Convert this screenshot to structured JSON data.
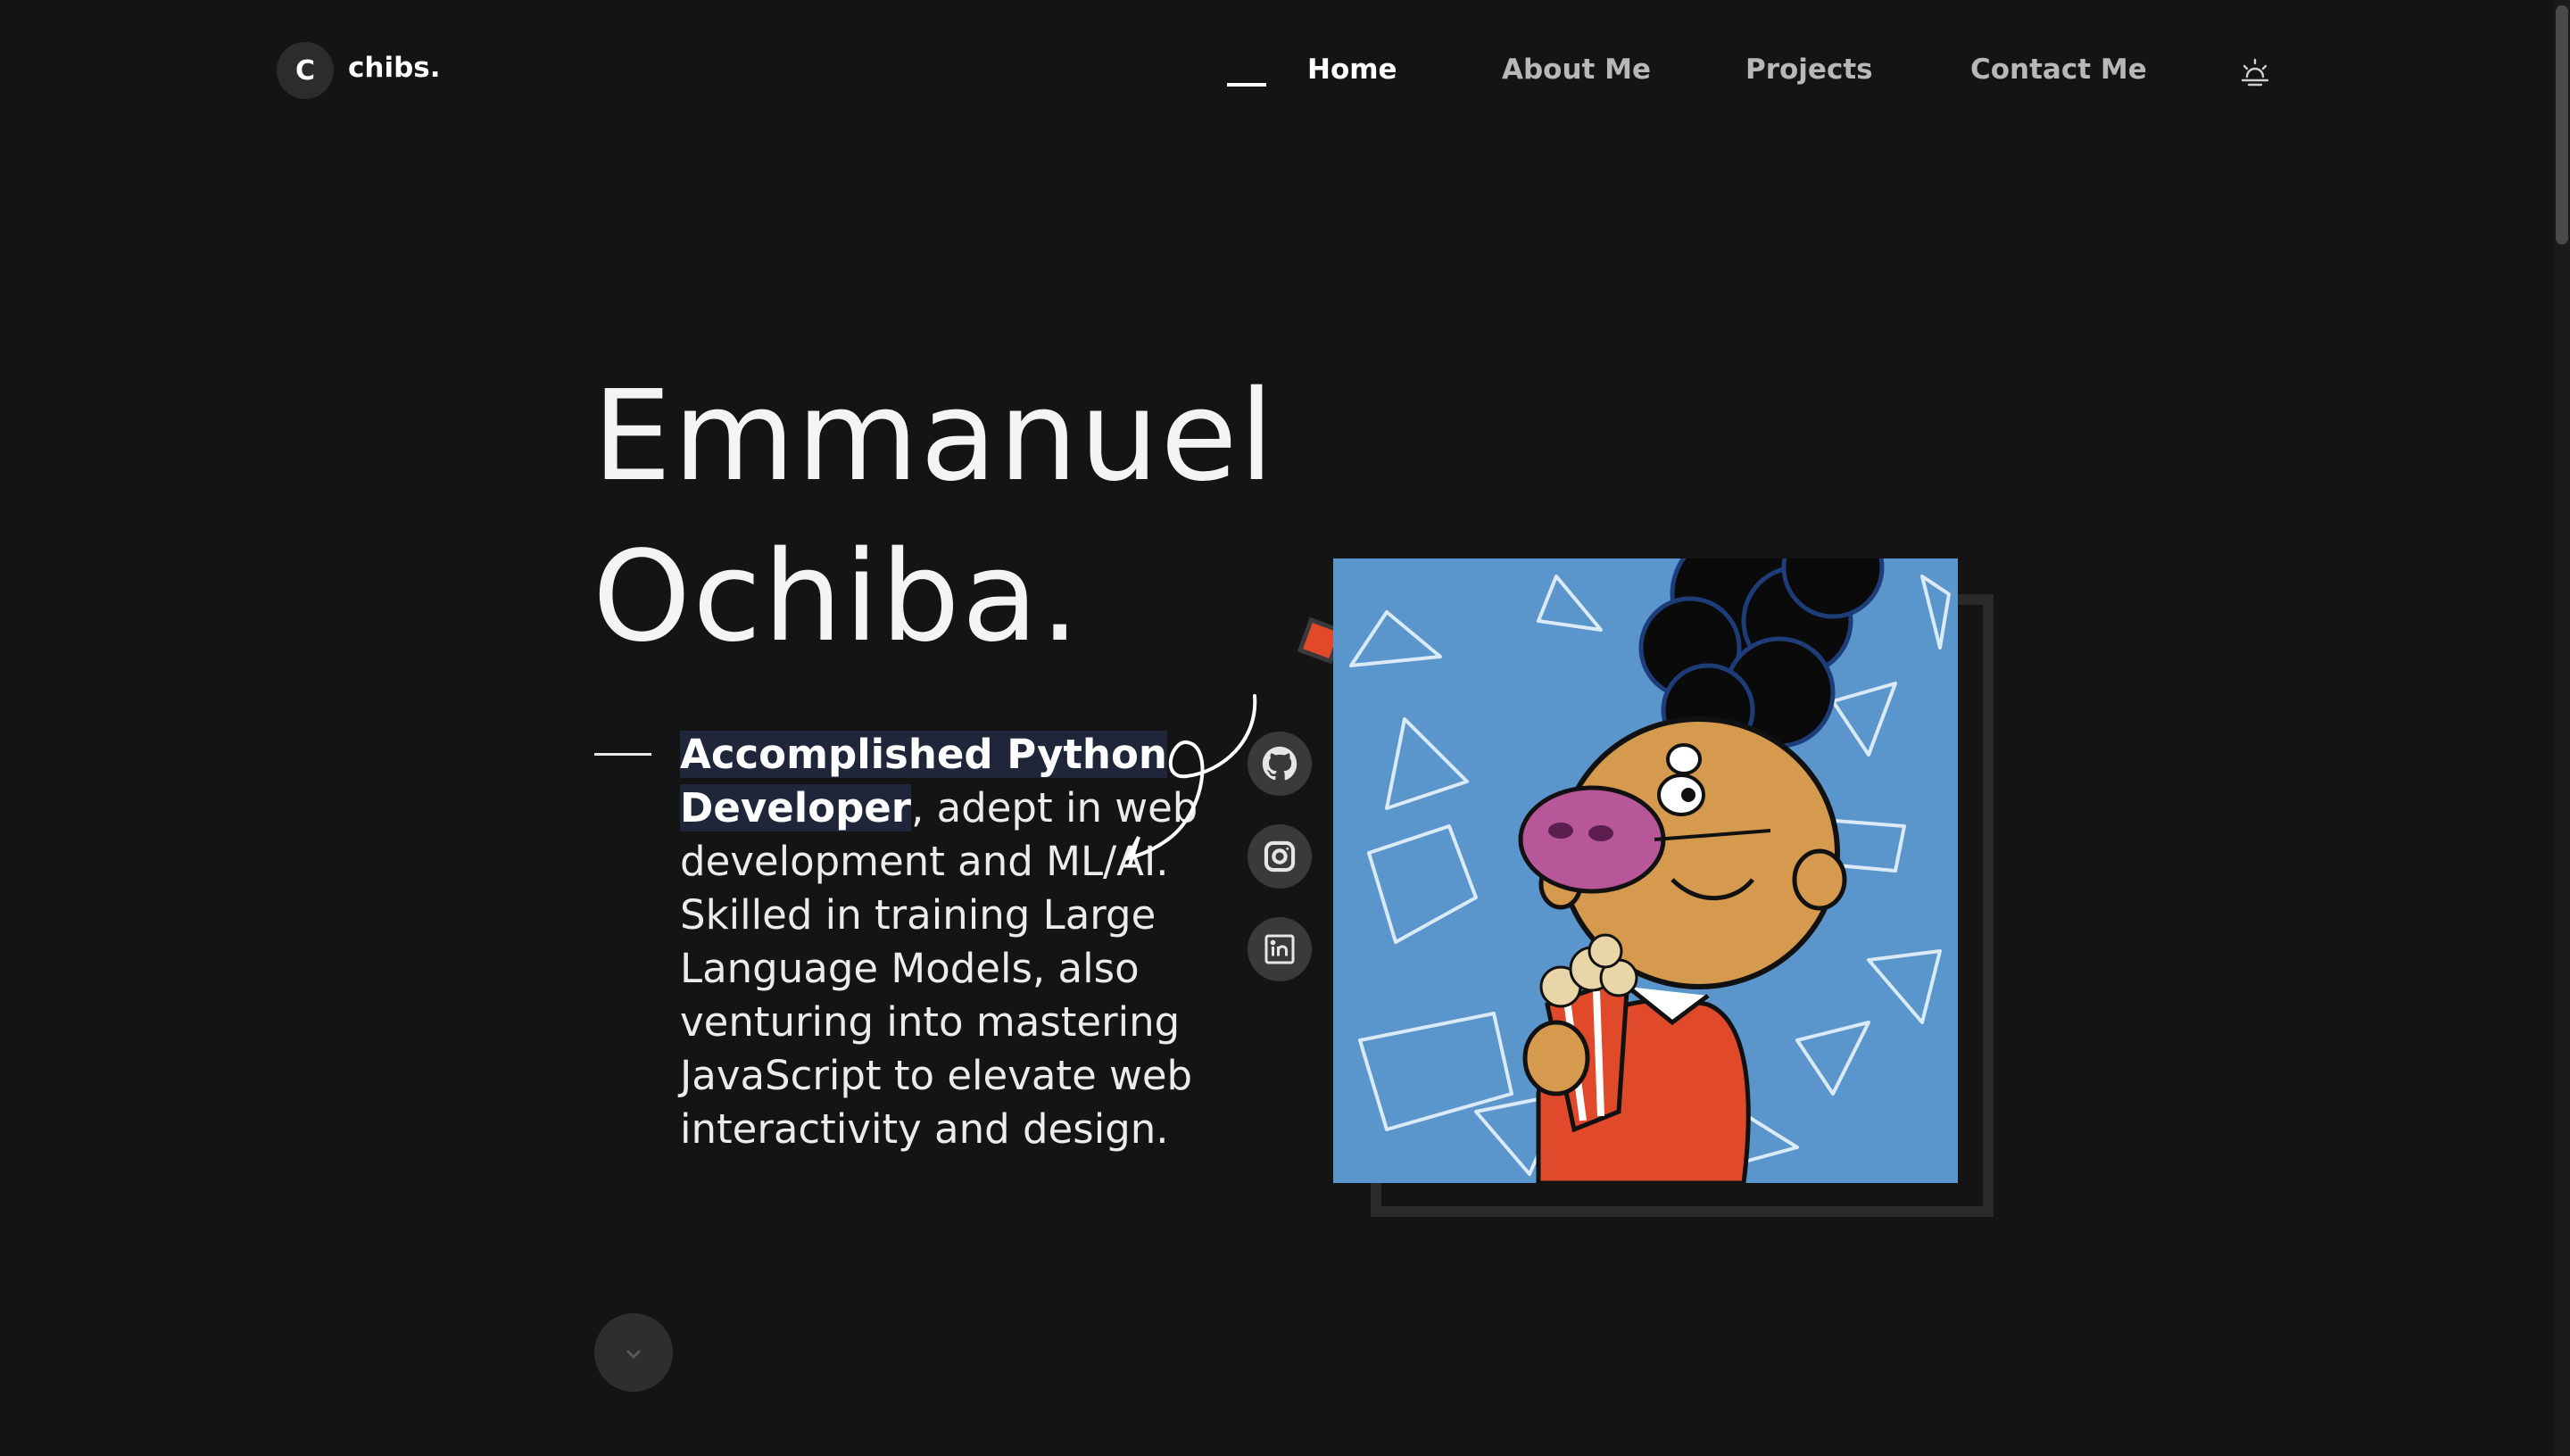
{
  "brand": {
    "initial": "C",
    "name": "chibs."
  },
  "nav": {
    "items": [
      {
        "label": "Home",
        "active": true
      },
      {
        "label": "About Me",
        "active": false
      },
      {
        "label": "Projects",
        "active": false
      },
      {
        "label": "Contact Me",
        "active": false
      }
    ],
    "theme_toggle_icon": "sun-half-icon"
  },
  "hero": {
    "first_name": "Emmanuel",
    "last_name": "Ochiba.",
    "highlight": "Accomplished Python Developer",
    "description": ", adept in web development and ML/AI. Skilled in training Large Language Models, also venturing into mastering JavaScript to elevate web interactivity and design."
  },
  "social": [
    "github-icon",
    "instagram-icon",
    "linkedin-icon"
  ],
  "colors": {
    "background": "#141414",
    "accent": "#e04a2a",
    "photo_bg": "#5a95cc",
    "highlight_bg": "#1f2639"
  }
}
